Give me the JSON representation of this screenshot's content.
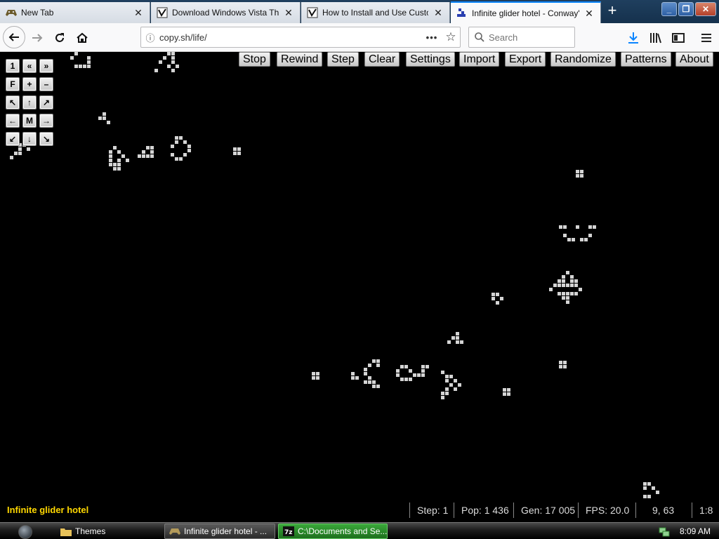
{
  "browser": {
    "tabs": [
      {
        "title": "New Tab",
        "icon": "gamepad-icon",
        "active": false
      },
      {
        "title": "Download Windows Vista Theme",
        "icon": "themes-site-icon",
        "active": false
      },
      {
        "title": "How to Install and Use Custom",
        "icon": "themes-site-icon",
        "active": false
      },
      {
        "title": "Infinite glider hotel - Conway's G",
        "icon": "life-site-icon",
        "active": true
      }
    ],
    "new_tab_label": "+",
    "url": "copy.sh/life/",
    "page_actions_label": "•••",
    "search_placeholder": "Search",
    "accent_color": "#0a84ff"
  },
  "life": {
    "controls": {
      "row1": [
        "1",
        "«",
        "»"
      ],
      "row2": [
        "F",
        "+",
        "–"
      ],
      "row3": [
        "↖",
        "↑",
        "↗"
      ],
      "row4": [
        "←",
        "M",
        "→"
      ],
      "row5": [
        "↙",
        "↓",
        "↘"
      ]
    },
    "menu": [
      "Stop",
      "Rewind",
      "Step",
      "Clear",
      "Settings",
      "Import",
      "Export",
      "Randomize",
      "Patterns",
      "About"
    ],
    "pattern_name": "Infinite glider hotel",
    "pattern_name_color": "#ffd800",
    "status": {
      "step": "Step: 1",
      "pop": "Pop: 1 436",
      "gen": "Gen: 17 005",
      "fps": "FPS: 20.0",
      "coords": "9, 63",
      "zoom": "1:8"
    },
    "cell_color": "#d4d4d4",
    "background_color": "#000000"
  },
  "taskbar": {
    "tasks": [
      {
        "label": "Themes",
        "icon": "folder-icon"
      },
      {
        "label": "Infinite glider hotel - ...",
        "icon": "gamepad-icon"
      },
      {
        "label": "C:\\Documents and Se...",
        "icon": "7zip-icon"
      }
    ],
    "time": "8:09 AM"
  }
}
